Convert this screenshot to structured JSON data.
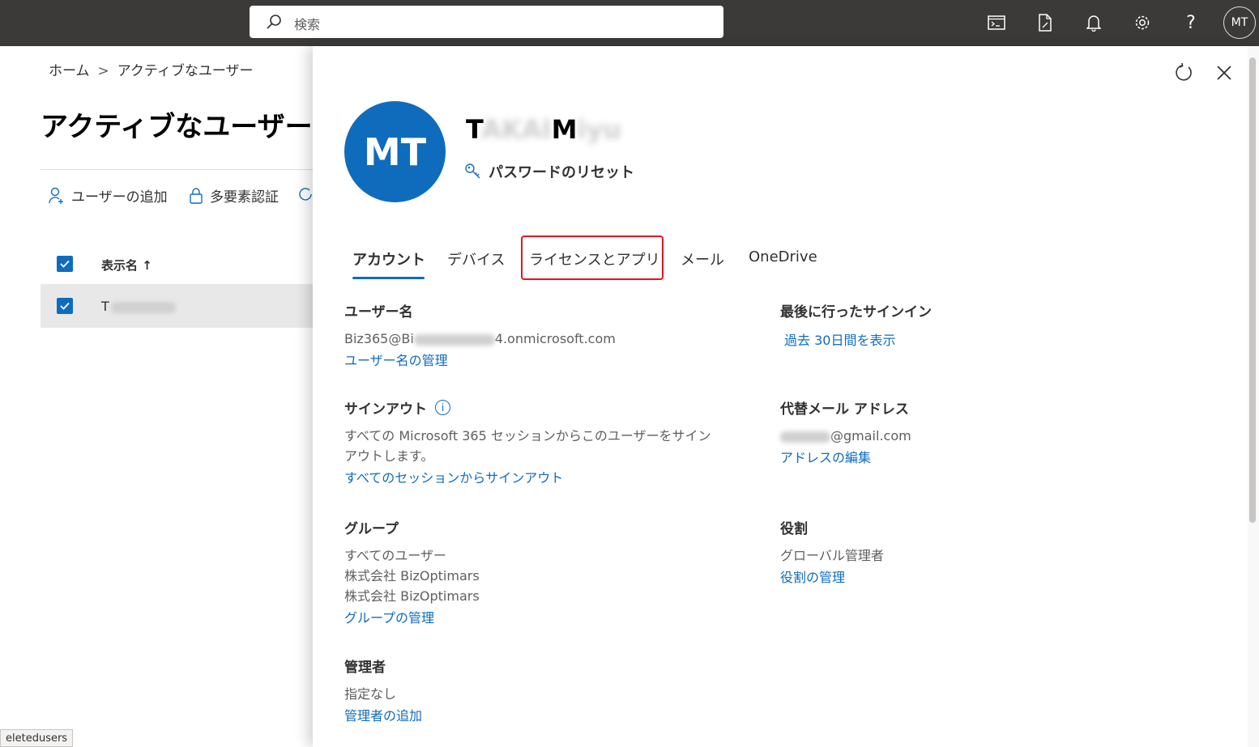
{
  "topbar": {
    "search_placeholder": "検索",
    "avatar_initials": "MT"
  },
  "background_page": {
    "breadcrumb": {
      "home": "ホーム",
      "sep": ">",
      "current": "アクティブなユーザー"
    },
    "title": "アクティブなユーザー",
    "commands": {
      "add_user": "ユーザーの追加",
      "mfa": "多要素認証"
    },
    "table": {
      "header_display_name": "表示名 ↑",
      "row_initial": "T"
    },
    "status_text": "eletedusers"
  },
  "panel": {
    "avatar_initials": "MT",
    "user_name": {
      "part1": "T",
      "part2": "AKAI",
      "part3": "M",
      "part4": "iyu"
    },
    "reset_password": "パスワードのリセット",
    "tabs": {
      "account": "アカウント",
      "devices": "デバイス",
      "licenses": "ライセンスとアプリ",
      "mail": "メール",
      "onedrive": "OneDrive"
    },
    "username": {
      "heading": "ユーザー名",
      "value_prefix": "Biz365@Bi",
      "value_suffix": "4.onmicrosoft.com",
      "link": "ユーザー名の管理"
    },
    "last_signin": {
      "heading": "最後に行ったサインイン",
      "link": "過去 30日間を表示"
    },
    "signout": {
      "heading": "サインアウト",
      "line1": "すべての Microsoft 365 セッションからこのユーザーをサイン",
      "line2": "アウトします。",
      "link": "すべてのセッションからサインアウト"
    },
    "alt_email": {
      "heading": "代替メール アドレス",
      "value_suffix": "@gmail.com",
      "link": "アドレスの編集"
    },
    "groups": {
      "heading": "グループ",
      "items": [
        "すべてのユーザー",
        "株式会社 BizOptimars",
        "株式会社 BizOptimars"
      ],
      "link": "グループの管理"
    },
    "roles": {
      "heading": "役割",
      "value": "グローバル管理者",
      "link": "役割の管理"
    },
    "manager": {
      "heading": "管理者",
      "value": "指定なし",
      "link": "管理者の追加"
    }
  }
}
